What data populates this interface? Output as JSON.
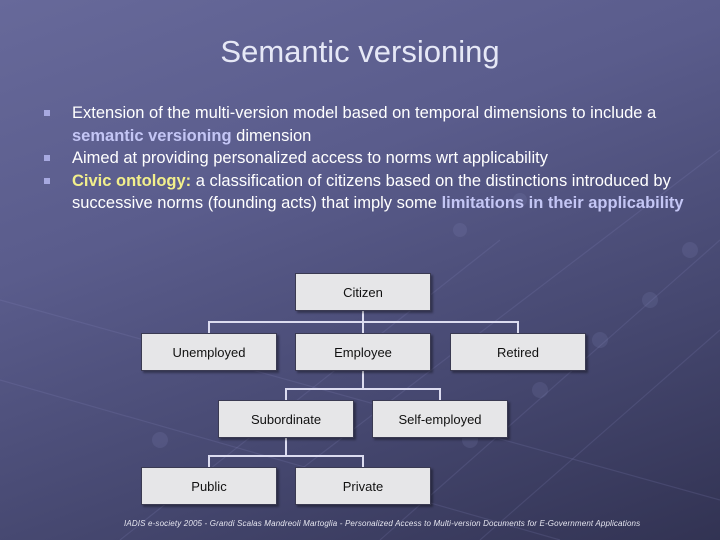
{
  "slide": {
    "title": "Semantic versioning",
    "bullets": [
      {
        "parts": [
          {
            "text": "Extension of the multi-version model based on temporal dimensions to include a ",
            "style": "normal"
          },
          {
            "text": "semantic versioning",
            "style": "highlight-blue"
          },
          {
            "text": " dimension",
            "style": "normal"
          }
        ]
      },
      {
        "parts": [
          {
            "text": "Aimed at providing personalized access to norms wrt applicability",
            "style": "normal"
          }
        ]
      },
      {
        "parts": [
          {
            "text": "Civic ontology:",
            "style": "highlight-yellow"
          },
          {
            "text": " a classification of citizens based on the distinctions introduced by successive norms (founding acts) that imply some ",
            "style": "normal"
          },
          {
            "text": "limitations in their applicability",
            "style": "highlight-blue"
          }
        ]
      }
    ],
    "bullet_icon": "square-bullet-icon",
    "footer": "IADIS e-society 2005 - Grandi Scalas Mandreoli Martoglia - Personalized Access to Multi-version Documents for E-Government Applications"
  },
  "diagram": {
    "type": "tree",
    "nodes": {
      "citizen": "Citizen",
      "unemployed": "Unemployed",
      "employee": "Employee",
      "retired": "Retired",
      "subordinate": "Subordinate",
      "self_employed": "Self-employed",
      "public": "Public",
      "private": "Private"
    },
    "edges": [
      [
        "citizen",
        "unemployed"
      ],
      [
        "citizen",
        "employee"
      ],
      [
        "citizen",
        "retired"
      ],
      [
        "employee",
        "subordinate"
      ],
      [
        "employee",
        "self_employed"
      ],
      [
        "subordinate",
        "public"
      ],
      [
        "subordinate",
        "private"
      ]
    ]
  },
  "colors": {
    "background": "#5a5c8c",
    "title_text": "#e6e8f6",
    "highlight_blue": "#c4c6f5",
    "highlight_yellow": "#f2ef8c",
    "node_fill": "#e6e6e8",
    "connector": "#dcdcf0"
  }
}
